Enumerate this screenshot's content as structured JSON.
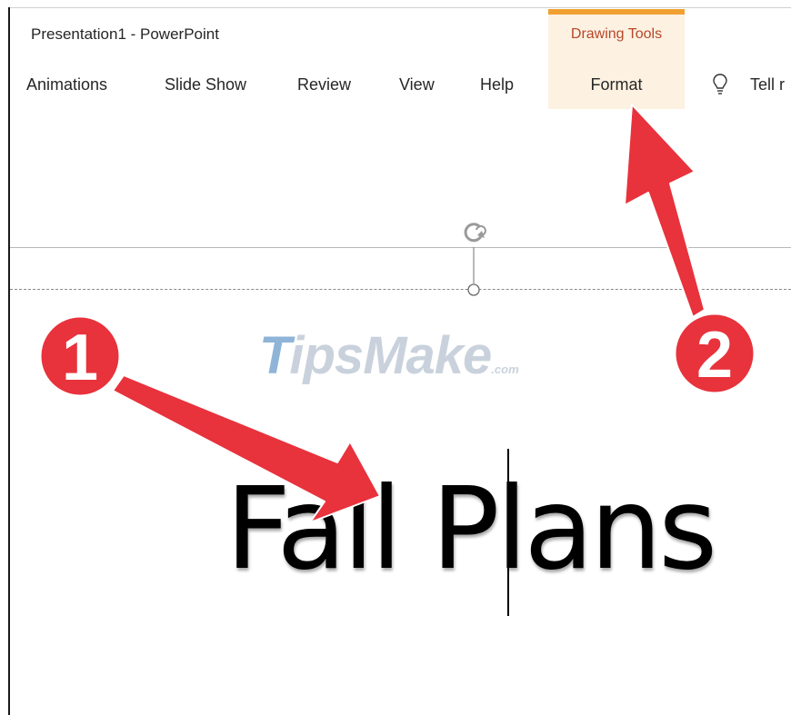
{
  "window": {
    "title": "Presentation1  -  PowerPoint"
  },
  "context_tab": {
    "label": "Drawing Tools",
    "accent_color": "#f0a030",
    "bg_color": "#fdf1e1",
    "text_color": "#b7472a"
  },
  "ribbon": {
    "tabs": [
      {
        "label": "Animations"
      },
      {
        "label": "Slide Show"
      },
      {
        "label": "Review"
      },
      {
        "label": "View"
      },
      {
        "label": "Help"
      },
      {
        "label": "Format"
      }
    ],
    "tell_me": {
      "icon": "lightbulb-icon",
      "label": "Tell r"
    }
  },
  "slide": {
    "title_text": "Fall Plans"
  },
  "watermark": {
    "first": "T",
    "rest": "ips",
    "brand": "Make",
    "domain": ".com"
  },
  "callouts": [
    {
      "number": "1",
      "color": "#e8323c"
    },
    {
      "number": "2",
      "color": "#e8323c"
    }
  ]
}
